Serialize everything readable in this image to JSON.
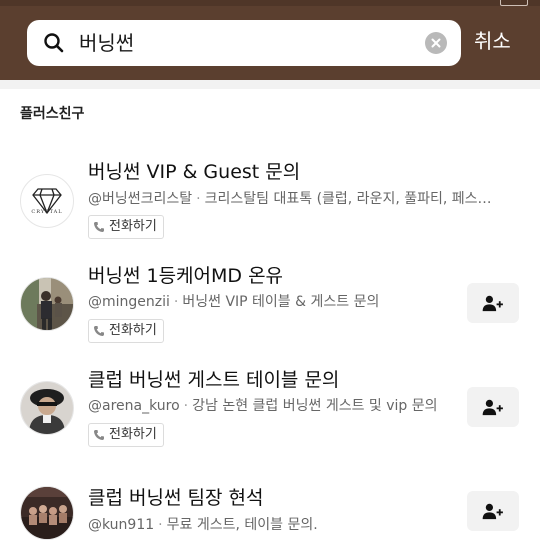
{
  "search": {
    "query": "버닝썬",
    "cancel_label": "취소"
  },
  "section": {
    "title": "플러스친구"
  },
  "results": [
    {
      "name": "버닝썬 VIP & Guest 문의",
      "handle": "@버닝썬크리스탈",
      "description": "크리스탈팀 대표톡 (클럽, 라운지, 풀파티, 페스…",
      "call_label": "전화하기",
      "avatar_text": "CRYSTAL",
      "has_add_button": false
    },
    {
      "name": "버닝썬 1등케어MD 온유",
      "handle": "@mingenzii",
      "description": "버닝썬 VIP 테이블 & 게스트 문의",
      "call_label": "전화하기",
      "has_add_button": true
    },
    {
      "name": "클럽 버닝썬 게스트 테이블 문의",
      "handle": "@arena_kuro",
      "description": "강남 논현 클럽 버닝썬 게스트 및 vip 문의",
      "call_label": "전화하기",
      "has_add_button": true
    },
    {
      "name": "클럽 버닝썬 팀장 현석",
      "handle": "@kun911",
      "description": "무료 게스트, 테이블 문의.",
      "has_add_button": true
    }
  ],
  "colors": {
    "header_bg": "#5b3f2f",
    "search_bg": "#ffffff",
    "add_button_bg": "#f2f2f2"
  },
  "icons": {
    "search": "search-icon",
    "clear": "clear-icon",
    "phone": "phone-icon",
    "add_friend": "add-friend-icon",
    "crystal_logo": "diamond-logo"
  }
}
